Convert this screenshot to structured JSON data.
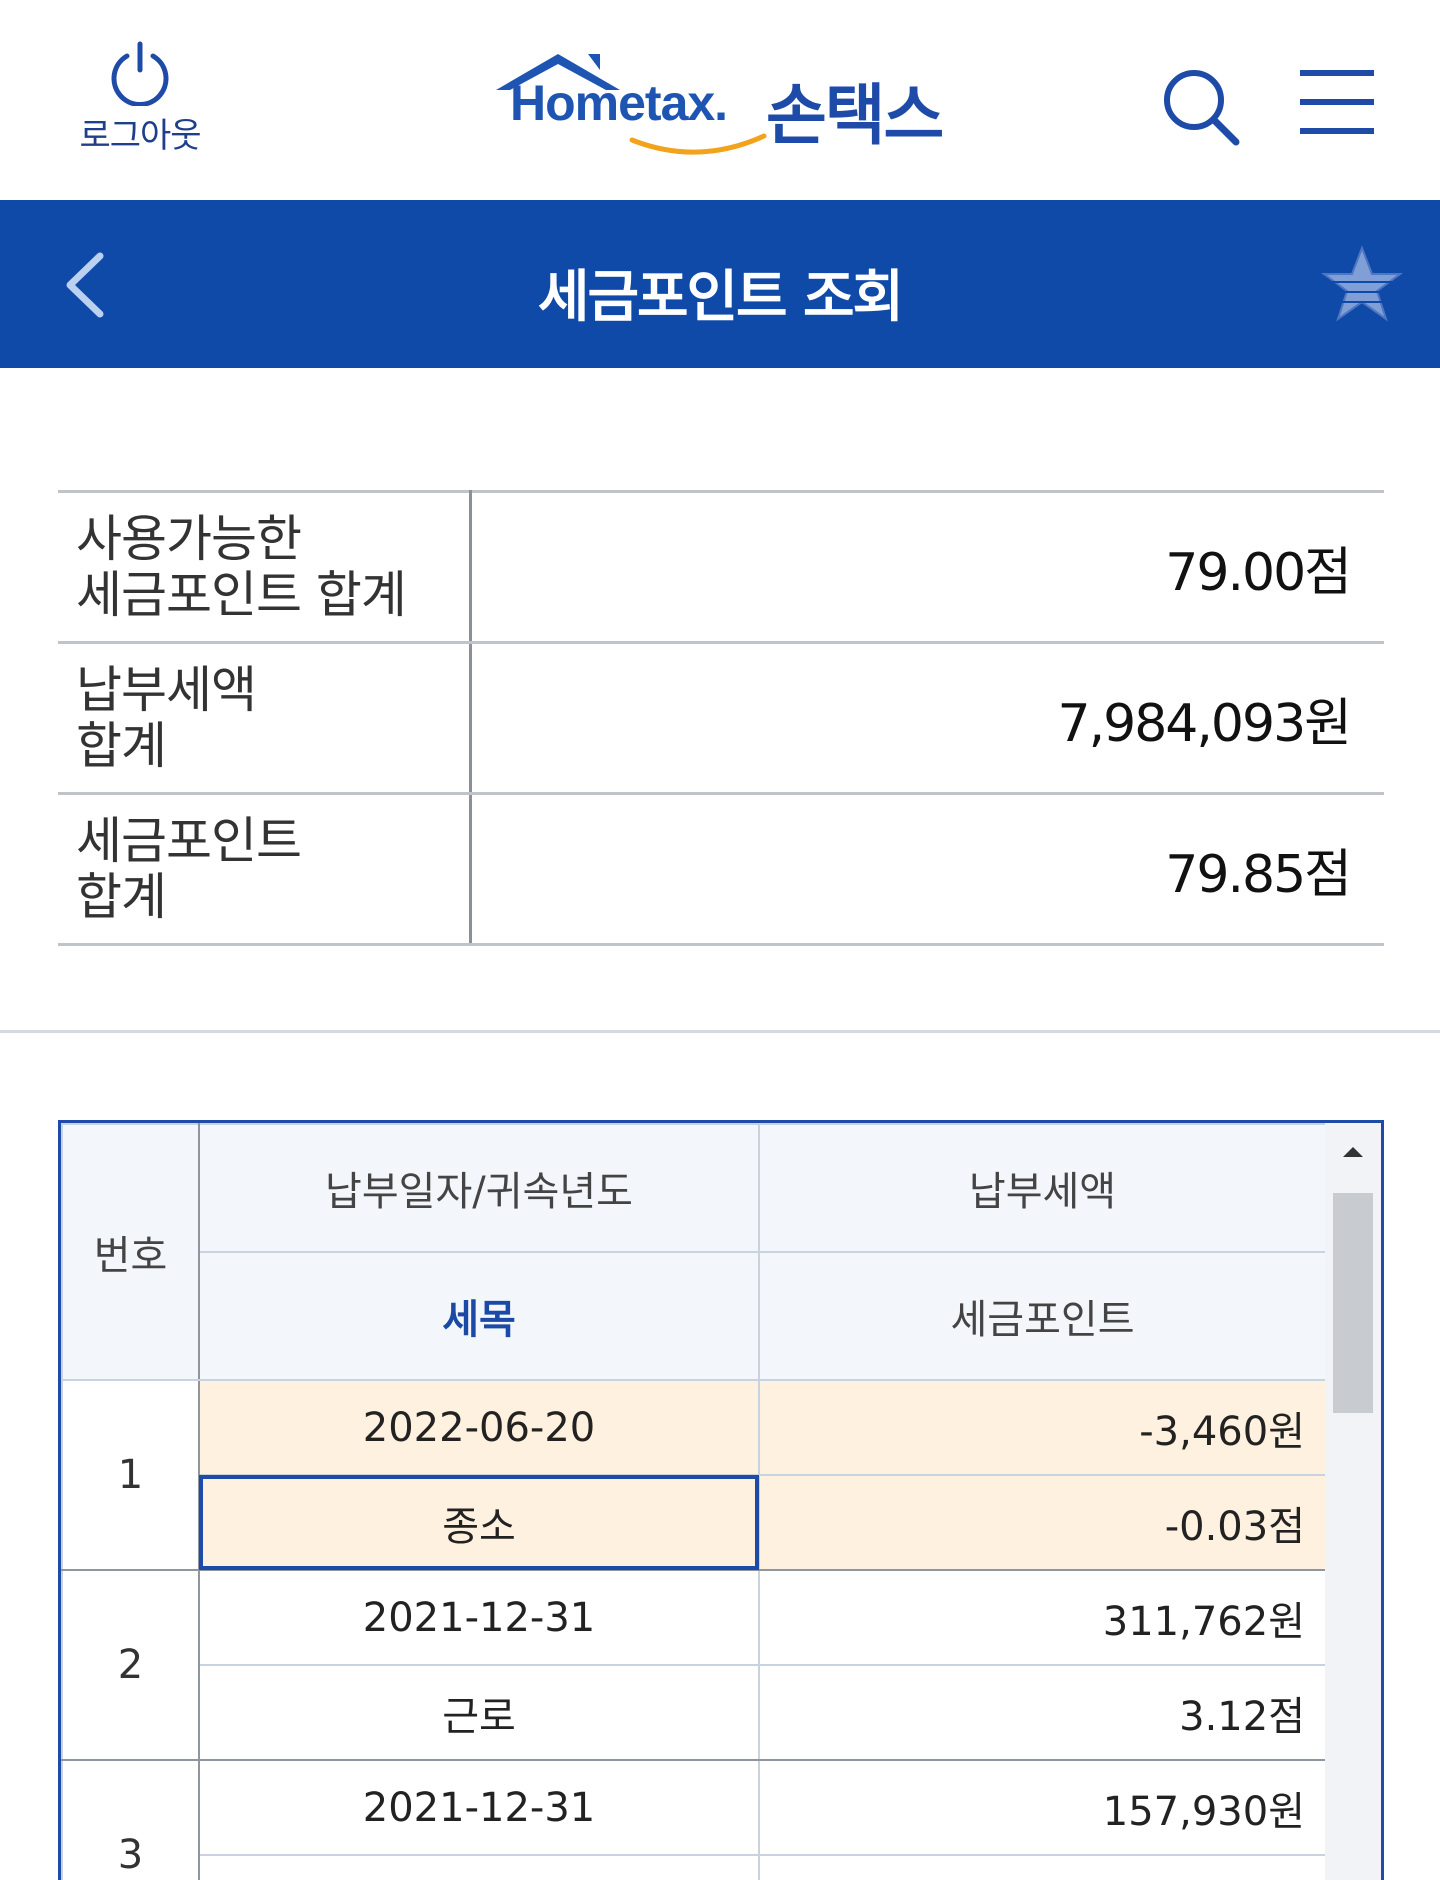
{
  "header": {
    "logout_label": "로그아웃",
    "logo_en": "Hometax.",
    "logo_ko": "손택스"
  },
  "titlebar": {
    "title": "세금포인트 조회"
  },
  "summary": {
    "rows": [
      {
        "label_line1": "사용가능한",
        "label_line2": "세금포인트 합계",
        "value": "79.00점"
      },
      {
        "label_line1": "납부세액",
        "label_line2": "합계",
        "value": "7,984,093원"
      },
      {
        "label_line1": "세금포인트",
        "label_line2": "합계",
        "value": "79.85점"
      }
    ]
  },
  "grid": {
    "headers": {
      "number": "번호",
      "date": "납부일자/귀속년도",
      "amount": "납부세액",
      "tax_item": "세목",
      "points": "세금포인트"
    },
    "rows": [
      {
        "number": "1",
        "date": "2022-06-20",
        "amount": "-3,460원",
        "tax_item": "종소",
        "points": "-0.03점"
      },
      {
        "number": "2",
        "date": "2021-12-31",
        "amount": "311,762원",
        "tax_item": "근로",
        "points": "3.12점"
      },
      {
        "number": "3",
        "date": "2021-12-31",
        "amount": "157,930원",
        "tax_item": "",
        "points": ""
      }
    ]
  },
  "colors": {
    "brand_blue": "#0f4aa9",
    "selected_row": "#fff1df",
    "header_bg": "#f3f6fa"
  },
  "icons": [
    "power-icon",
    "search-icon",
    "menu-icon",
    "back-arrow-icon",
    "star-icon",
    "scroll-up-icon"
  ]
}
